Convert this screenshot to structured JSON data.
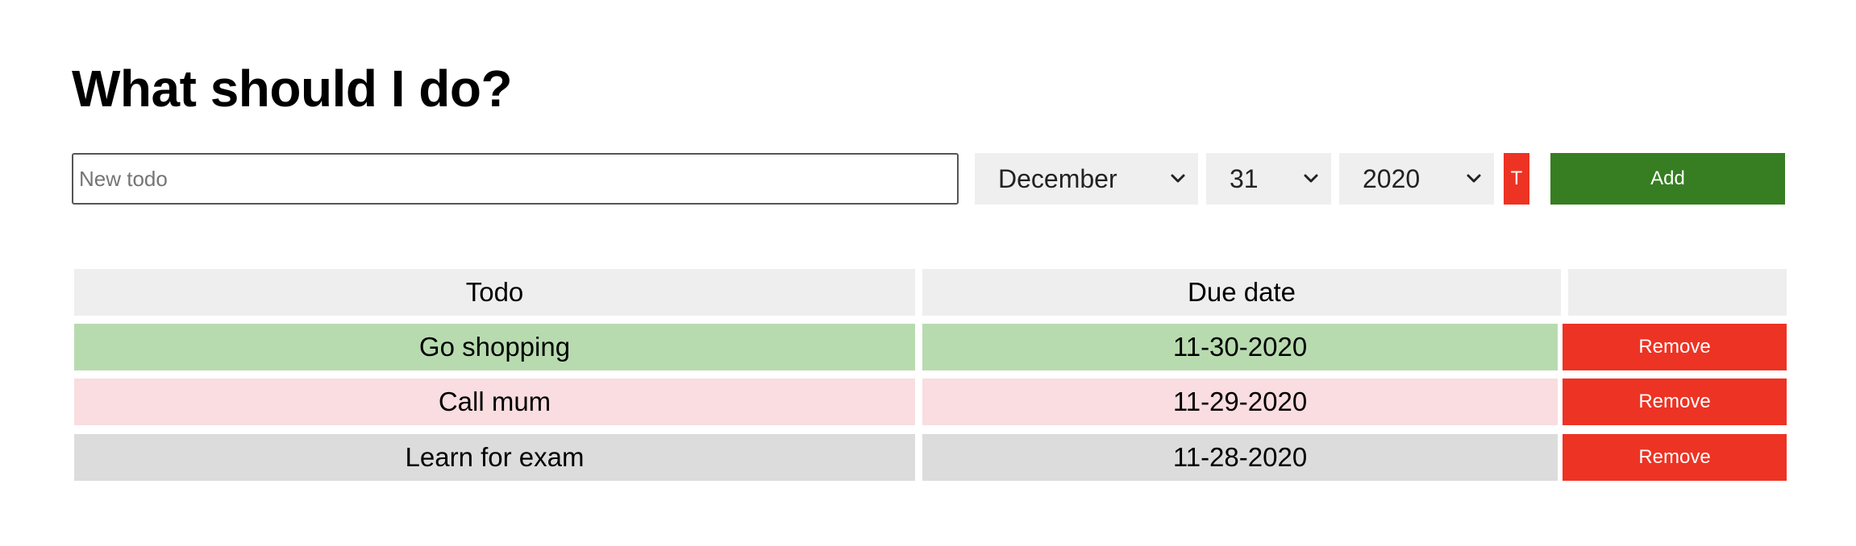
{
  "title": "What should I do?",
  "form": {
    "todo_placeholder": "New todo",
    "todo_value": "",
    "month": "December",
    "day": "31",
    "year": "2020",
    "today_label": "T",
    "add_label": "Add"
  },
  "table": {
    "headers": [
      "Todo",
      "Due date",
      ""
    ],
    "rows": [
      {
        "todo": "Go shopping",
        "due": "11-30-2020",
        "action": "Remove",
        "status_color": "#b7dbaf"
      },
      {
        "todo": "Call mum",
        "due": "11-29-2020",
        "action": "Remove",
        "status_color": "#f9dde0"
      },
      {
        "todo": "Learn for exam",
        "due": "11-28-2020",
        "action": "Remove",
        "status_color": "#dcdcdc"
      }
    ]
  },
  "colors": {
    "add_button": "#377d22",
    "remove_button": "#ed3324",
    "today_button": "#ed3324",
    "header_bg": "#eeeeee"
  },
  "icons": {
    "select_arrow": "chevron-down-icon"
  }
}
